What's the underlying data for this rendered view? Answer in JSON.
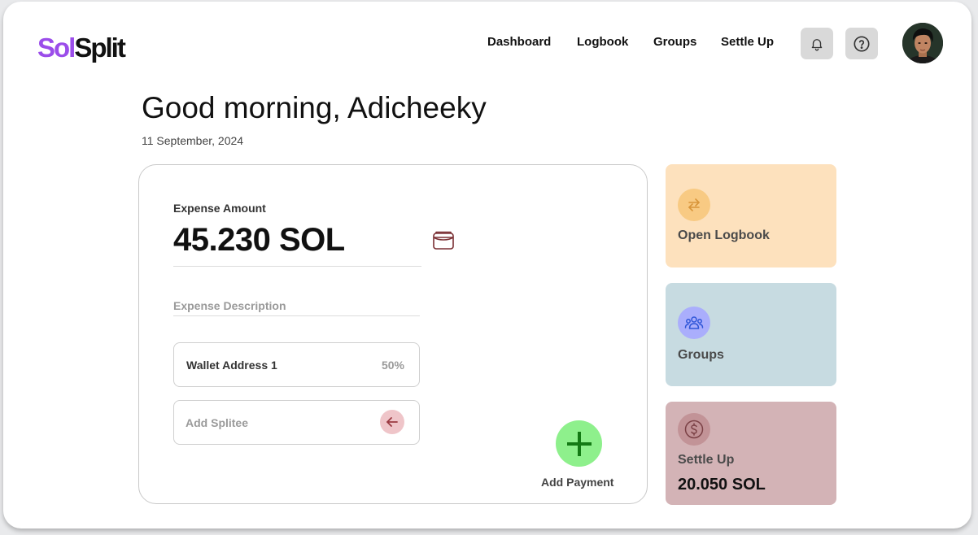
{
  "brand": {
    "part1": "Sol",
    "part2": "Split",
    "color1": "#9b4dea",
    "color2": "#111111"
  },
  "nav": {
    "dashboard": "Dashboard",
    "logbook": "Logbook",
    "groups": "Groups",
    "settle_up": "Settle Up"
  },
  "header_icons": {
    "notifications": "bell-icon",
    "help": "help-icon"
  },
  "greeting": "Good morning, Adicheeky",
  "date": "11 September, 2024",
  "expense": {
    "amount_label": "Expense Amount",
    "amount": "45.230 SOL",
    "description_placeholder": "Expense Description",
    "wallet": {
      "label": "Wallet Address 1",
      "share": "50%"
    },
    "splitee_placeholder": "Add Splitee",
    "add_payment_label": "Add Payment"
  },
  "tiles": {
    "logbook": {
      "label": "Open Logbook",
      "icon": "swap-arrows-icon",
      "color": "#fde1bd"
    },
    "groups": {
      "label": "Groups",
      "icon": "people-icon",
      "color": "#c7dbe1"
    },
    "settle": {
      "label": "Settle Up",
      "amount": "20.050 SOL",
      "icon": "dollar-icon",
      "color": "#d3b3b6"
    }
  }
}
